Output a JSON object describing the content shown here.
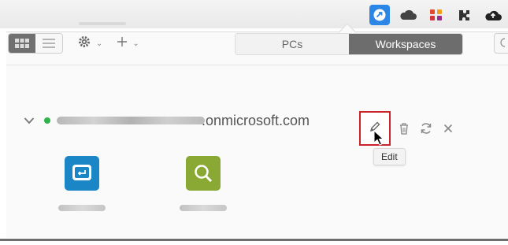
{
  "menubar": {
    "icons": [
      "remote-desktop-icon",
      "cloud-icon",
      "puzzle-app-icon",
      "puzzle-icon",
      "cloud-upload-icon"
    ],
    "accent": "#2b86e6"
  },
  "toolbar": {
    "view_icons": [
      "grid-view-icon",
      "list-view-icon"
    ],
    "settings_icon": "gear-icon",
    "add_icon": "plus-icon"
  },
  "tabs": [
    {
      "label": "PCs",
      "active": false
    },
    {
      "label": "Workspaces",
      "active": true
    }
  ],
  "workspace": {
    "domain": ".onmicrosoft.com",
    "status_color": "#2fb34a",
    "actions": [
      "edit-icon",
      "delete-icon",
      "refresh-icon",
      "close-icon"
    ],
    "highlight_color": "#c8252b"
  },
  "tooltip": {
    "text": "Edit"
  },
  "apps": [
    {
      "icon": "remote-desktop-app-icon",
      "color": "#1b86c5"
    },
    {
      "icon": "magnifier-app-icon",
      "color": "#8aa834"
    }
  ]
}
